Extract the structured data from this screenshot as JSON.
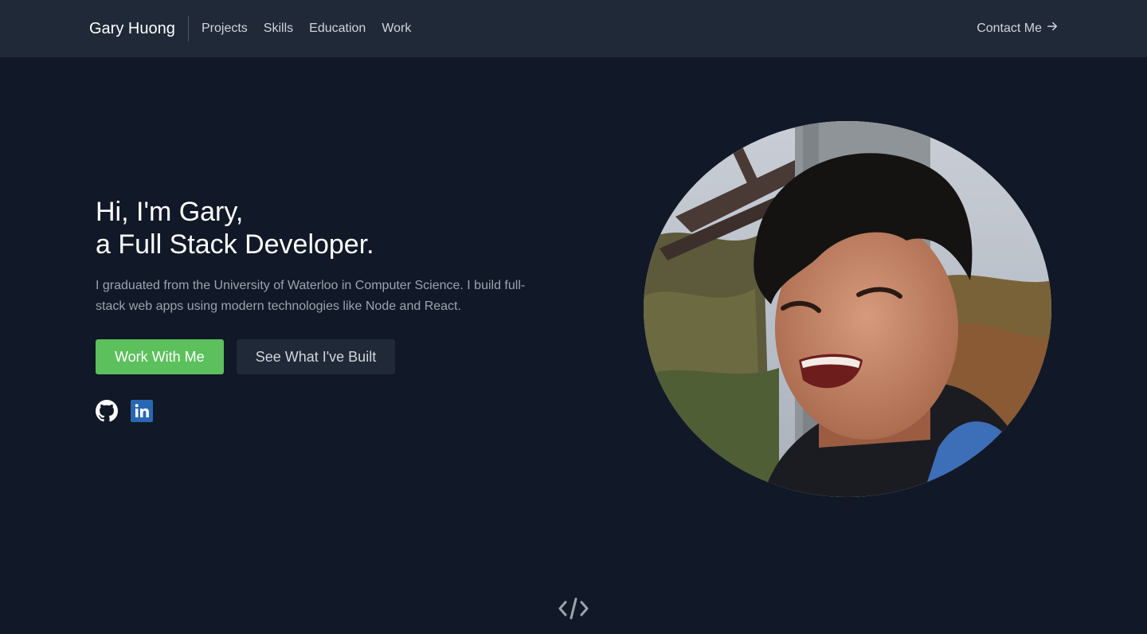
{
  "nav": {
    "brand": "Gary Huong",
    "links": [
      {
        "label": "Projects"
      },
      {
        "label": "Skills"
      },
      {
        "label": "Education"
      },
      {
        "label": "Work"
      }
    ],
    "contact_label": "Contact Me",
    "contact_icon": "arrow-right-icon"
  },
  "hero": {
    "headline_line1": "Hi, I'm Gary,",
    "headline_line2": "a Full Stack Developer.",
    "bio": "I graduated from the University of Waterloo in Computer Science. I build full-stack web apps using modern technologies like Node and React.",
    "primary_button": "Work With Me",
    "secondary_button": "See What I've Built",
    "socials": [
      {
        "icon": "github-icon"
      },
      {
        "icon": "linkedin-icon"
      }
    ],
    "portrait_icon": "profile-photo"
  },
  "footer": {
    "icon": "code-icon"
  },
  "colors": {
    "background": "#111827",
    "navbar": "#1f2937",
    "accent_green": "#5cc05c",
    "linkedin_blue": "#2867b2",
    "text_muted": "#9ca3af"
  }
}
